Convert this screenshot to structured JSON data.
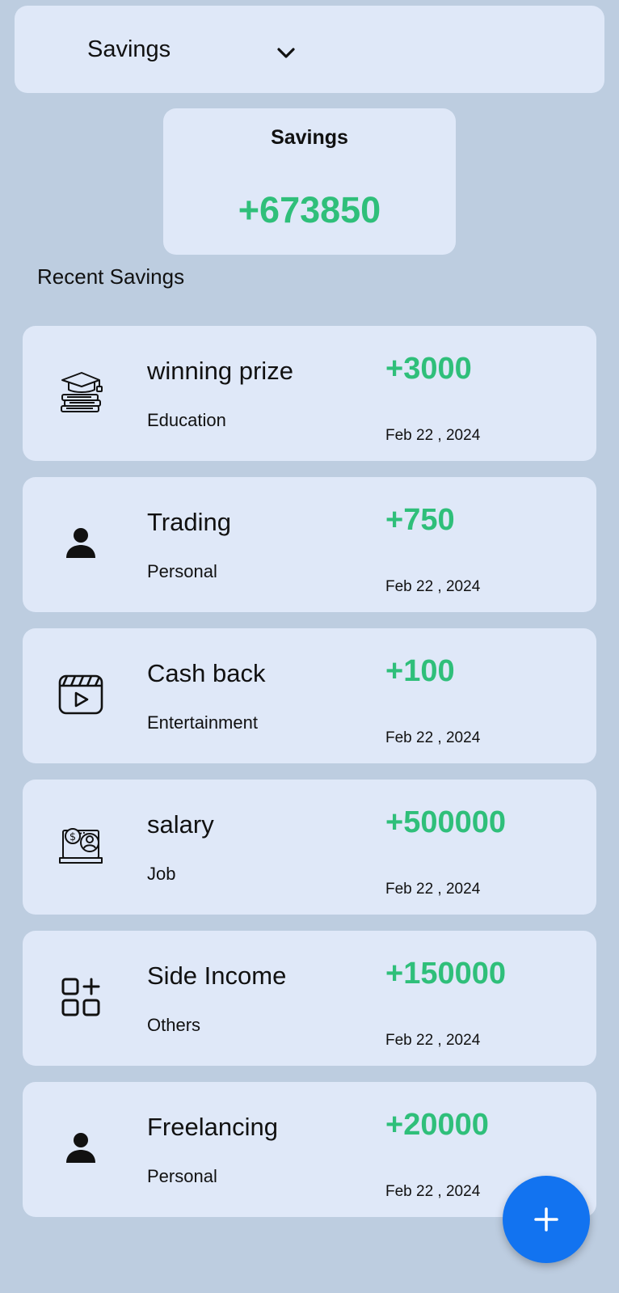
{
  "dropdown": {
    "selected": "Savings",
    "icon": "chevron-down-icon"
  },
  "total": {
    "title": "Savings",
    "amount": "+673850"
  },
  "recent_title": "Recent Savings",
  "colors": {
    "positive": "#2fbf7a",
    "card_bg": "#dfe8f8",
    "page_bg": "#bdcde0",
    "fab": "#1273f0"
  },
  "transactions": [
    {
      "title": "winning prize",
      "category": "Education",
      "amount": "+3000",
      "date": "Feb 22 , 2024",
      "icon": "education-icon"
    },
    {
      "title": "Trading",
      "category": "Personal",
      "amount": "+750",
      "date": "Feb 22 , 2024",
      "icon": "person-icon"
    },
    {
      "title": "Cash back",
      "category": "Entertainment",
      "amount": "+100",
      "date": "Feb 22 , 2024",
      "icon": "video-clapper-icon"
    },
    {
      "title": "salary",
      "category": "Job",
      "amount": "+500000",
      "date": "Feb 22 , 2024",
      "icon": "salary-icon"
    },
    {
      "title": "Side Income",
      "category": "Others",
      "amount": "+150000",
      "date": "Feb 22 , 2024",
      "icon": "apps-grid-icon"
    },
    {
      "title": "Freelancing",
      "category": "Personal",
      "amount": "+20000",
      "date": "Feb 22 , 2024",
      "icon": "person-icon"
    }
  ],
  "fab": {
    "icon": "plus-icon"
  }
}
